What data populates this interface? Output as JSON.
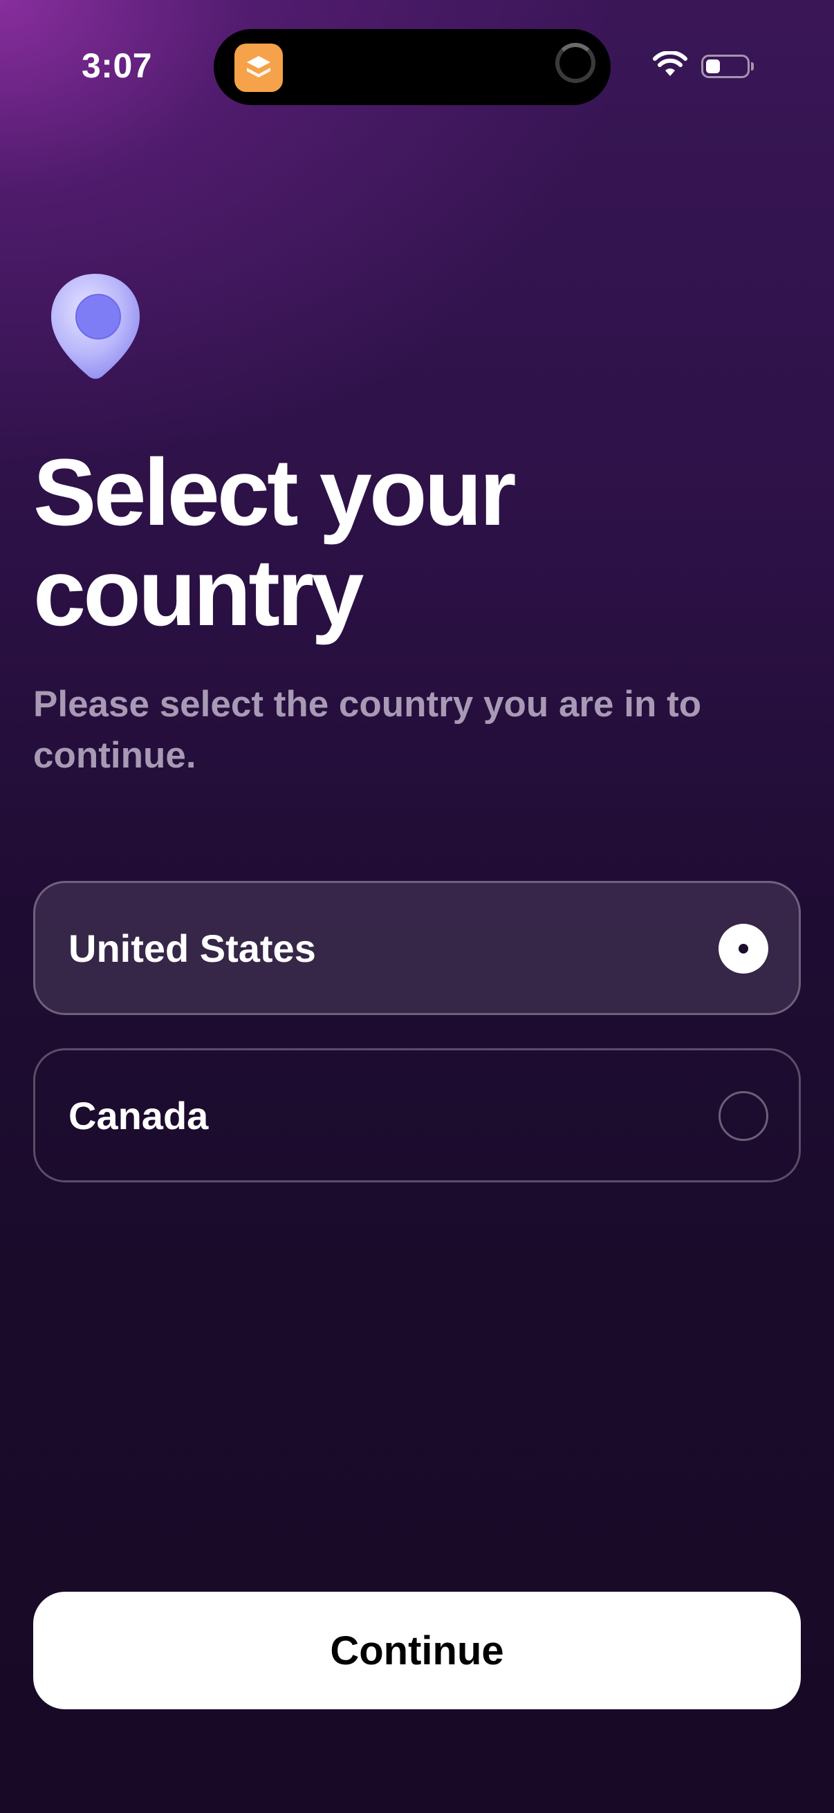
{
  "status_bar": {
    "time": "3:07",
    "island_app_icon": "layers-stack-icon",
    "wifi_icon": "wifi-icon",
    "battery_icon": "battery-icon"
  },
  "hero": {
    "icon": "location-pin-icon",
    "title_line1": "Select your",
    "title_line2": "country",
    "subtitle": "Please select the country you are in to continue."
  },
  "countries": [
    {
      "label": "United States",
      "selected": true
    },
    {
      "label": "Canada",
      "selected": false
    }
  ],
  "actions": {
    "continue_label": "Continue"
  },
  "colors": {
    "background_top": "#3a1657",
    "background_bottom": "#180a26",
    "accent_pin": "#8c8cf7",
    "subtitle": "#a89ab4",
    "button_bg": "#ffffff"
  }
}
